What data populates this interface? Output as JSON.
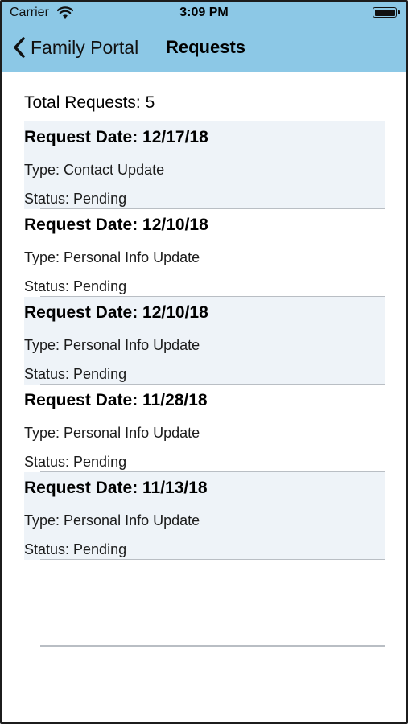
{
  "status_bar": {
    "carrier": "Carrier",
    "time": "3:09 PM"
  },
  "nav": {
    "back_label": "Family Portal",
    "title": "Requests"
  },
  "summary": {
    "total_label": "Total Requests: 5"
  },
  "requests": [
    {
      "date": "Request Date: 12/17/18",
      "type": "Type: Contact Update",
      "status": "Status: Pending"
    },
    {
      "date": "Request Date: 12/10/18",
      "type": "Type: Personal Info Update",
      "status": "Status: Pending"
    },
    {
      "date": "Request Date: 12/10/18",
      "type": "Type: Personal Info Update",
      "status": "Status: Pending"
    },
    {
      "date": "Request Date: 11/28/18",
      "type": "Type: Personal Info Update",
      "status": "Status: Pending"
    },
    {
      "date": "Request Date: 11/13/18",
      "type": "Type: Personal Info Update",
      "status": "Status: Pending"
    }
  ],
  "colors": {
    "header": "#8cc8e6",
    "row_shade": "#eef3f8",
    "separator": "#b9bec4"
  },
  "icons": {
    "back": "chevron-left-icon",
    "wifi": "wifi-icon",
    "battery": "battery-icon"
  }
}
